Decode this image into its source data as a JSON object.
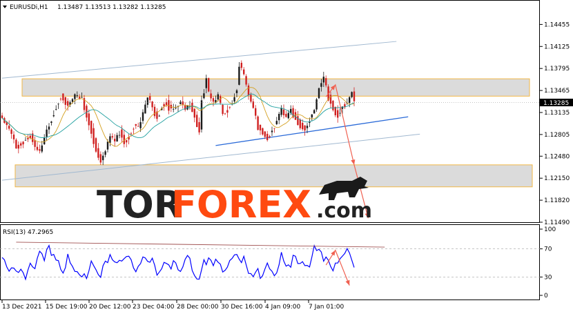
{
  "header": {
    "symbol": "EURUSDi,H1",
    "ohlc": "1.13487 1.13513 1.13282 1.13285"
  },
  "watermark": {
    "part1": "TOR",
    "part2": "FOREX",
    "part3": ".com"
  },
  "colors": {
    "bull": "#1a1a1a",
    "bear": "#d02020",
    "ma_fast": "#d4a020",
    "ma_slow": "#20a0a0",
    "channel": "#a0b8d0",
    "support": "#2a6ad8",
    "zone_border": "#f0b030",
    "zone_fill": "#d8d8d8",
    "rsi": "#0000ff",
    "forecast": "#f06050",
    "watermark_dark": "#222222",
    "watermark_accent": "#ff4a10"
  },
  "chart_data": [
    {
      "type": "candlestick",
      "title": "EURUSDi,H1",
      "ylim": [
        1.1149,
        1.1478
      ],
      "y_ticks": [
        "1.14455",
        "1.14125",
        "1.13795",
        "1.13465",
        "1.13285",
        "1.13135",
        "1.12805",
        "1.12480",
        "1.12150",
        "1.11820",
        "1.11490"
      ],
      "current_price": "1.13285",
      "x_ticks": [
        "13 Dec 2021",
        "15 Dec 19:00",
        "20 Dec 12:00",
        "23 Dec 04:00",
        "28 Dec 00:00",
        "30 Dec 16:00",
        "4 Jan 09:00",
        "7 Jan 01:00"
      ],
      "series": [
        {
          "name": "close",
          "anchors": [
            [
              0,
              1.1305
            ],
            [
              3,
              1.1288
            ],
            [
              6,
              1.1265
            ],
            [
              9,
              1.1272
            ],
            [
              12,
              1.1282
            ],
            [
              14,
              1.1262
            ],
            [
              16,
              1.1255
            ],
            [
              19,
              1.1288
            ],
            [
              22,
              1.1318
            ],
            [
              25,
              1.1342
            ],
            [
              28,
              1.1325
            ],
            [
              31,
              1.1338
            ],
            [
              34,
              1.1335
            ],
            [
              36,
              1.1312
            ],
            [
              38,
              1.129
            ],
            [
              40,
              1.126
            ],
            [
              42,
              1.1242
            ],
            [
              44,
              1.1258
            ],
            [
              46,
              1.1278
            ],
            [
              48,
              1.127
            ],
            [
              50,
              1.1288
            ],
            [
              52,
              1.1272
            ],
            [
              54,
              1.1282
            ],
            [
              56,
              1.1296
            ],
            [
              58,
              1.129
            ],
            [
              60,
              1.1312
            ],
            [
              62,
              1.1338
            ],
            [
              64,
              1.1322
            ],
            [
              66,
              1.1308
            ],
            [
              68,
              1.1326
            ],
            [
              70,
              1.1332
            ],
            [
              72,
              1.1318
            ],
            [
              74,
              1.1322
            ],
            [
              76,
              1.133
            ],
            [
              78,
              1.1318
            ],
            [
              80,
              1.1328
            ],
            [
              82,
              1.131
            ],
            [
              84,
              1.1288
            ],
            [
              85,
              1.1335
            ],
            [
              87,
              1.1365
            ],
            [
              88,
              1.1342
            ],
            [
              90,
              1.1328
            ],
            [
              92,
              1.1338
            ],
            [
              94,
              1.1312
            ],
            [
              96,
              1.1322
            ],
            [
              98,
              1.133
            ],
            [
              100,
              1.1355
            ],
            [
              101,
              1.1388
            ],
            [
              103,
              1.1368
            ],
            [
              105,
              1.134
            ],
            [
              107,
              1.132
            ],
            [
              109,
              1.1295
            ],
            [
              111,
              1.1285
            ],
            [
              113,
              1.1278
            ],
            [
              115,
              1.129
            ],
            [
              117,
              1.1302
            ],
            [
              119,
              1.1318
            ],
            [
              121,
              1.1305
            ],
            [
              123,
              1.132
            ],
            [
              125,
              1.1308
            ],
            [
              127,
              1.1298
            ],
            [
              129,
              1.129
            ],
            [
              131,
              1.1306
            ],
            [
              133,
              1.1318
            ],
            [
              135,
              1.1352
            ],
            [
              137,
              1.1365
            ],
            [
              139,
              1.134
            ],
            [
              141,
              1.1322
            ],
            [
              143,
              1.1312
            ],
            [
              145,
              1.1326
            ],
            [
              147,
              1.1328
            ],
            [
              149,
              1.1345
            ],
            [
              150,
              1.133
            ]
          ]
        },
        {
          "name": "ma_fast"
        },
        {
          "name": "ma_slow"
        }
      ],
      "annotations": {
        "channel_upper": [
          [
            0,
            1.1365
          ],
          [
            168,
            1.142
          ]
        ],
        "channel_lower": [
          [
            0,
            1.1212
          ],
          [
            178,
            1.1281
          ]
        ],
        "support_line": [
          [
            91,
            1.1264
          ],
          [
            173,
            1.1307
          ]
        ],
        "resistance_zone": [
          1.1338,
          1.1364
        ],
        "support_zone": [
          1.1202,
          1.1235
        ],
        "forecast_path": [
          [
            138,
            1.1337
          ],
          [
            142,
            1.1355
          ],
          [
            150,
            1.1235
          ],
          [
            156,
            1.1155
          ]
        ]
      }
    },
    {
      "type": "line",
      "title": "RSI(13) 47.2965",
      "ylim": [
        0,
        100
      ],
      "y_ticks": [
        "100",
        "70",
        "30",
        "0"
      ],
      "levels": [
        70,
        30
      ],
      "anchors": [
        [
          0,
          55
        ],
        [
          2,
          45
        ],
        [
          4,
          40
        ],
        [
          6,
          52
        ],
        [
          8,
          48
        ],
        [
          10,
          38
        ],
        [
          12,
          55
        ],
        [
          14,
          45
        ],
        [
          16,
          62
        ],
        [
          18,
          58
        ],
        [
          20,
          70
        ],
        [
          22,
          72
        ],
        [
          24,
          60
        ],
        [
          26,
          50
        ],
        [
          28,
          58
        ],
        [
          30,
          42
        ],
        [
          32,
          35
        ],
        [
          34,
          28
        ],
        [
          36,
          42
        ],
        [
          38,
          62
        ],
        [
          40,
          55
        ],
        [
          42,
          40
        ],
        [
          44,
          48
        ],
        [
          46,
          58
        ],
        [
          48,
          48
        ],
        [
          50,
          56
        ],
        [
          52,
          68
        ],
        [
          54,
          72
        ],
        [
          56,
          55
        ],
        [
          58,
          48
        ],
        [
          60,
          60
        ],
        [
          62,
          50
        ],
        [
          64,
          56
        ],
        [
          66,
          45
        ],
        [
          68,
          50
        ],
        [
          70,
          62
        ],
        [
          72,
          55
        ],
        [
          74,
          48
        ],
        [
          76,
          40
        ],
        [
          78,
          55
        ],
        [
          80,
          62
        ],
        [
          82,
          42
        ],
        [
          84,
          35
        ],
        [
          86,
          65
        ],
        [
          88,
          58
        ],
        [
          90,
          48
        ],
        [
          92,
          55
        ],
        [
          94,
          38
        ],
        [
          96,
          58
        ],
        [
          98,
          65
        ],
        [
          100,
          74
        ],
        [
          101,
          70
        ],
        [
          103,
          55
        ],
        [
          105,
          35
        ],
        [
          107,
          30
        ],
        [
          109,
          40
        ],
        [
          111,
          45
        ],
        [
          113,
          58
        ],
        [
          115,
          48
        ],
        [
          117,
          42
        ],
        [
          119,
          62
        ],
        [
          121,
          50
        ],
        [
          123,
          48
        ],
        [
          125,
          65
        ],
        [
          127,
          58
        ],
        [
          129,
          60
        ],
        [
          131,
          55
        ],
        [
          133,
          72
        ],
        [
          135,
          68
        ],
        [
          137,
          55
        ],
        [
          139,
          52
        ],
        [
          141,
          48
        ],
        [
          143,
          62
        ],
        [
          145,
          70
        ],
        [
          147,
          68
        ],
        [
          149,
          58
        ],
        [
          150,
          47
        ]
      ],
      "trend_line": [
        [
          6,
          79.5
        ],
        [
          163,
          72.5
        ]
      ],
      "forecast_path": [
        [
          138,
          47
        ],
        [
          142,
          68
        ],
        [
          148,
          18
        ]
      ]
    }
  ]
}
